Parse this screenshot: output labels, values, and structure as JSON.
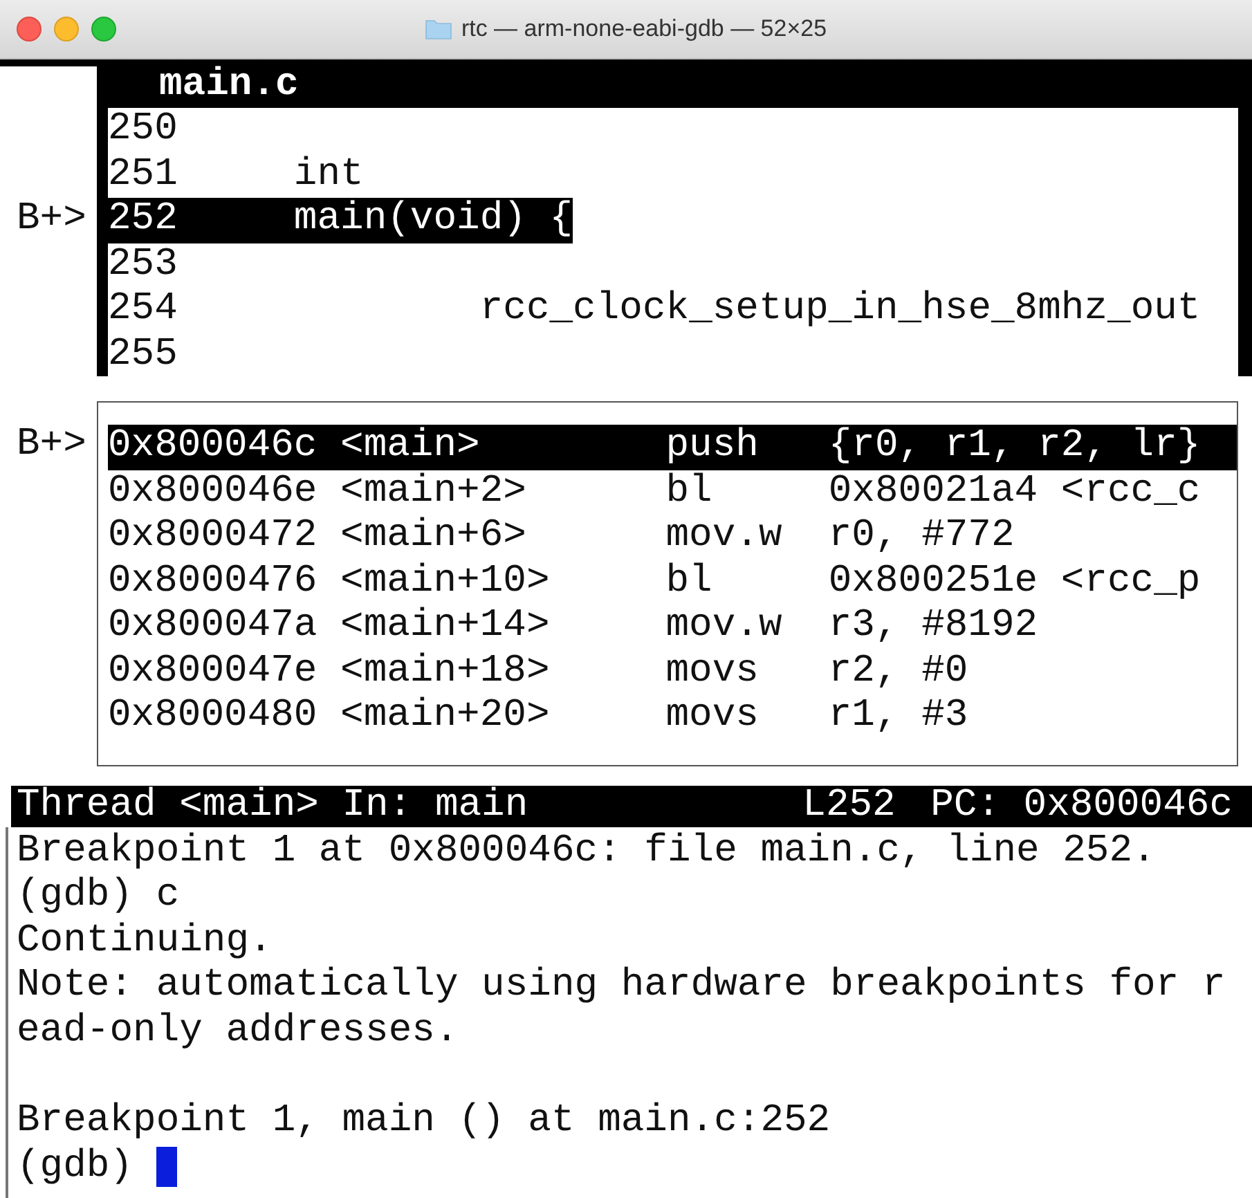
{
  "window": {
    "title": "rtc — arm-none-eabi-gdb — 52×25"
  },
  "source_pane": {
    "title": "main.c",
    "lines": [
      {
        "number": "250",
        "selected": false
      },
      {
        "number": "251",
        "code": "     int",
        "selected": false
      },
      {
        "marker": "B+>",
        "number": "252",
        "code": "     main(void) {",
        "selected": true
      },
      {
        "number": "253",
        "selected": false
      },
      {
        "number": "254",
        "code": "             rcc_clock_setup_in_hse_8mhz_out",
        "selected": false
      },
      {
        "number": "255",
        "selected": false
      }
    ]
  },
  "asm_pane": {
    "rows": [
      {
        "marker": "B+>",
        "address": "0x800046c",
        "symbol": "<main>",
        "mnemonic": "push",
        "operands": "{r0, r1, r2, lr}",
        "selected": true
      },
      {
        "address": "0x800046e",
        "symbol": "<main+2>",
        "mnemonic": "bl",
        "operands": "0x80021a4 <rcc_c",
        "selected": false
      },
      {
        "address": "0x8000472",
        "symbol": "<main+6>",
        "mnemonic": "mov.w",
        "operands": "r0, #772",
        "selected": false
      },
      {
        "address": "0x8000476",
        "symbol": "<main+10>",
        "mnemonic": "bl",
        "operands": "0x800251e <rcc_p",
        "selected": false
      },
      {
        "address": "0x800047a",
        "symbol": "<main+14>",
        "mnemonic": "mov.w",
        "operands": "r3, #8192",
        "selected": false
      },
      {
        "address": "0x800047e",
        "symbol": "<main+18>",
        "mnemonic": "movs",
        "operands": "r2, #0",
        "selected": false
      },
      {
        "address": "0x8000480",
        "symbol": "<main+20>",
        "mnemonic": "movs",
        "operands": "r1, #3",
        "selected": false
      }
    ]
  },
  "status_bar": {
    "left": "Thread <main> In: main",
    "line": "L252",
    "pc": "PC: 0x800046c"
  },
  "command_output": [
    [
      "Breakpoint 1 at 0x800046c: file main.c, line 252.",
      "(gdb) c",
      "Continuing.",
      "Note: automatically using hardware breakpoints for r",
      "ead-only addresses."
    ],
    [
      "Breakpoint 1, main () at main.c:252"
    ]
  ],
  "prompt": {
    "text": "(gdb)",
    "cursor": true
  }
}
